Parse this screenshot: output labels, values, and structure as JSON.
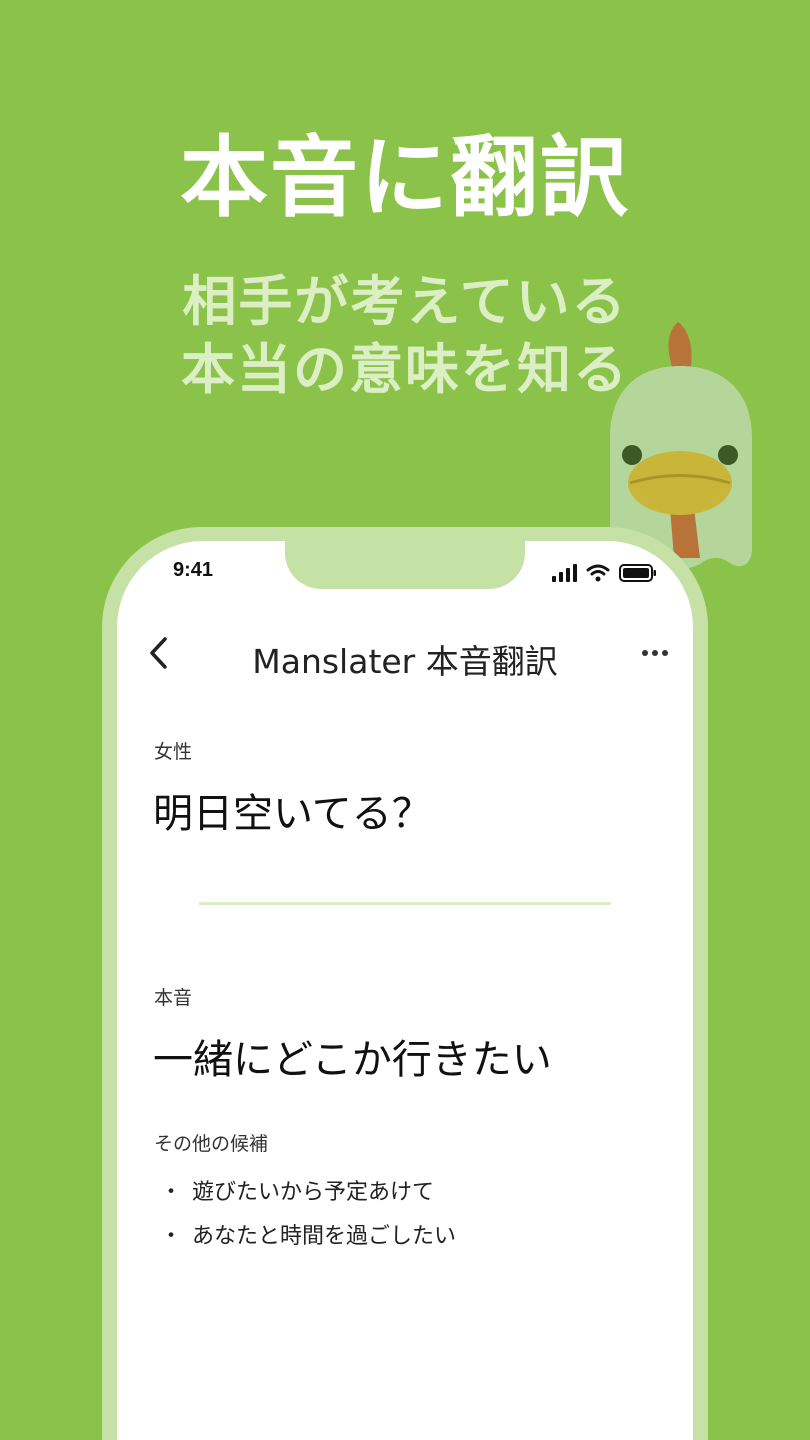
{
  "promo": {
    "headline": "本音に翻訳",
    "subline_1": "相手が考えている",
    "subline_2": "本当の意味を知る"
  },
  "status_bar": {
    "time": "9:41"
  },
  "nav": {
    "back_icon": "chevron-left-icon",
    "title": "Manslater 本音翻訳",
    "more_icon": "more-horizontal-icon"
  },
  "source": {
    "label": "女性",
    "text": "明日空いてる？"
  },
  "translation": {
    "label": "本音",
    "text": "一緒にどこか行きたい"
  },
  "alternatives": {
    "label": "その他の候補",
    "bullet": "・",
    "items": [
      "遊びたいから予定あけて",
      "あなたと時間を過ごしたい"
    ]
  },
  "colors": {
    "background": "#8bc34a",
    "phone_frame": "#c5e1a5",
    "subline": "#dcefc4",
    "mascot_body": "#b5d69a",
    "mascot_beak": "#c9b53a",
    "mascot_comb": "#b87339"
  }
}
